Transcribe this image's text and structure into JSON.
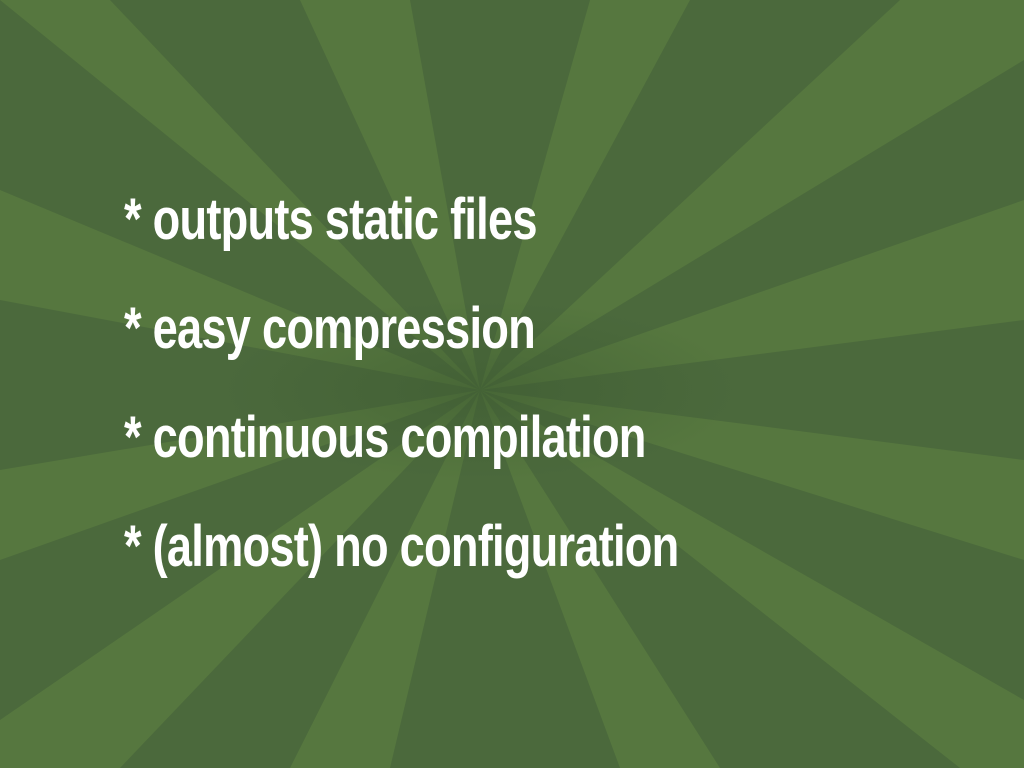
{
  "slide": {
    "background_color": "#4b693c",
    "ray_light_color": "#56773f",
    "text_color": "#ffffff",
    "bullets": [
      {
        "marker": "*",
        "text": "outputs static files"
      },
      {
        "marker": "*",
        "text": "easy compression"
      },
      {
        "marker": "*",
        "text": "continuous compilation"
      },
      {
        "marker": "*",
        "text": "(almost) no configuration"
      }
    ]
  }
}
